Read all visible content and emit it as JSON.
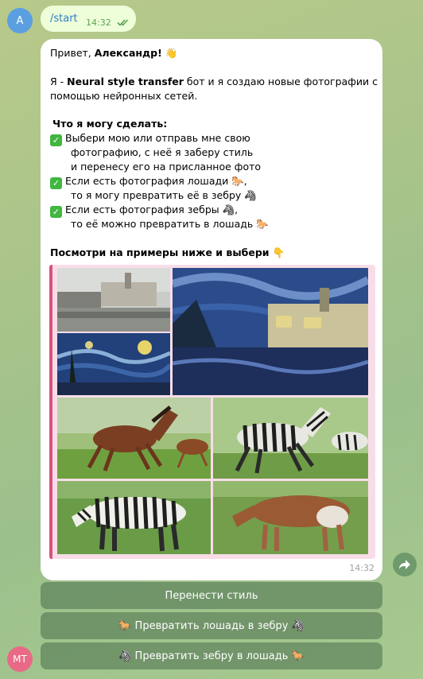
{
  "chat": {
    "user_avatar_initial": "A",
    "user_message": {
      "text": "/start",
      "time": "14:32"
    },
    "bot_message": {
      "greeting_prefix": "Привет, ",
      "greeting_name": "Александр!",
      "greeting_emoji": "👋",
      "intro_prefix": "Я - ",
      "intro_bot_name": "Neural style transfer",
      "intro_suffix": " бот и я создаю новые фотографии с",
      "intro_line2": "помощью нейронных сетей.",
      "capabilities_title": "Что я могу сделать:",
      "item1_line1": "Выбери мою или отправь мне свою",
      "item1_line2": "фотографию, с неё я заберу стиль",
      "item1_line3": "и перенесу его на присланное фото",
      "item2_line1": "Если есть фотография лошади 🐎,",
      "item2_line2": "то я могу превратить её в зебру 🦓",
      "item3_line1": "Если есть фотография зебры 🦓,",
      "item3_line2": "то её можно превратить в лошадь 🐎",
      "examples_prompt": "Посмотри на примеры ниже и выбери",
      "examples_emoji": "👇",
      "time": "14:32"
    },
    "keyboard": {
      "button1": "Перенести стиль",
      "button2": "🐎 Превратить лошадь в зебру 🦓",
      "button3": "🦓 Превратить зебру в лошадь 🐎"
    },
    "bottom_avatar_initials": "MT"
  },
  "colors": {
    "outgoing_bubble": "#eefed9",
    "link": "#2f7dc4",
    "check": "#41b640",
    "gallery_accent": "#d9527d"
  }
}
